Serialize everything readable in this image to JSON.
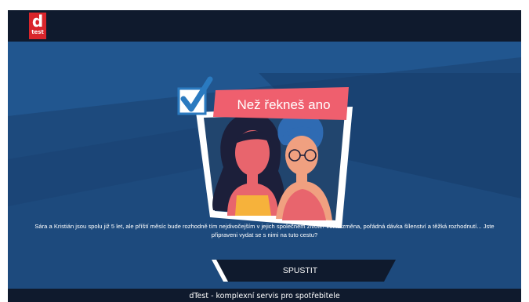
{
  "header": {
    "logo_big": "d",
    "logo_small": "test",
    "logo_name": "dTest logo"
  },
  "game": {
    "title": "Než řekneš ano",
    "description": "Sára a Kristián jsou spolu již 5 let, ale příští měsíc bude rozhodně tím nejdivočejším v jejich společném životě! Velká změna, pořádná dávka šílenství a těžká rozhodnutí... Jste připraveni vydat se s nimi na tuto cestu?",
    "start_label": "SPUSTIT",
    "icon": "checkbox-checked-icon"
  },
  "footer": {
    "text": "dTest - komplexní servis pro spotřebitele"
  },
  "colors": {
    "background": "#1d4a7d",
    "bar": "#0f1a2d",
    "title_banner": "#ef5f6e",
    "accent": "#d9252b",
    "checkbox": "#2a7ac0"
  }
}
